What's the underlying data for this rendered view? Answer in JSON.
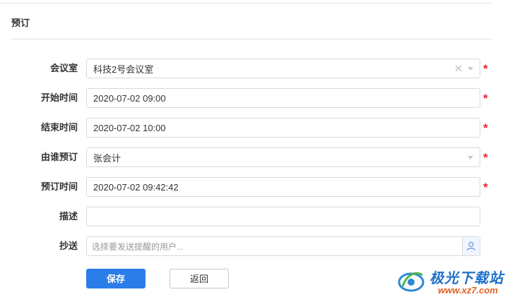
{
  "panel": {
    "title": "预订"
  },
  "form": {
    "room": {
      "label": "会议室",
      "value": "科技2号会议室",
      "required_mark": "*"
    },
    "start": {
      "label": "开始时间",
      "value": "2020-07-02 09:00",
      "required_mark": "*"
    },
    "end": {
      "label": "结束时间",
      "value": "2020-07-02 10:00",
      "required_mark": "*"
    },
    "booker": {
      "label": "由谁预订",
      "value": "张会计",
      "required_mark": "*"
    },
    "booked_at": {
      "label": "预订时间",
      "value": "2020-07-02 09:42:42",
      "required_mark": "*"
    },
    "description": {
      "label": "描述",
      "value": ""
    },
    "cc": {
      "label": "抄送",
      "placeholder": "选择要发送提醒的用户..."
    }
  },
  "actions": {
    "save_label": "保存",
    "back_label": "返回"
  },
  "watermark": {
    "brand": "极光下载站",
    "url": "www.xz7.com"
  },
  "icons": {
    "clear": "clear-x-icon",
    "caret": "chevron-down-icon",
    "user_picker": "user-icon"
  },
  "colors": {
    "primary": "#2b7de9",
    "required": "#f5222d",
    "border": "#d9d9d9",
    "placeholder": "#999999"
  }
}
